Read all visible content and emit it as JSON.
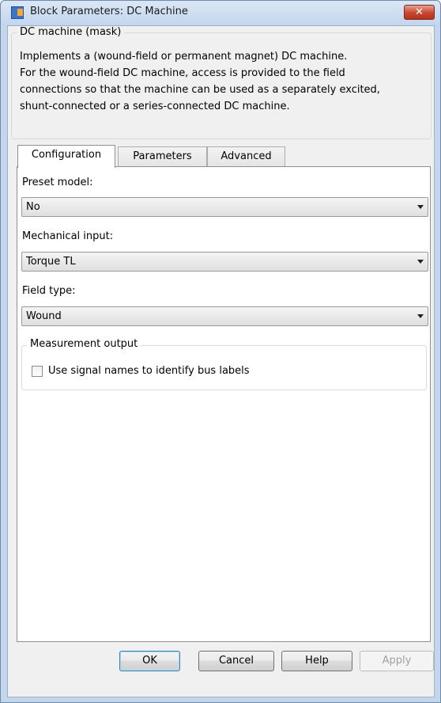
{
  "window": {
    "title": "Block Parameters: DC Machine",
    "close_label": "✕"
  },
  "description": {
    "legend": "DC machine (mask)",
    "text": "Implements a (wound-field or permanent magnet) DC machine.\nFor the wound-field DC machine, access is provided to the field\nconnections so that the machine can be used as a separately excited,\nshunt-connected or a series-connected  DC machine."
  },
  "tabs": [
    {
      "label": "Configuration",
      "active": true
    },
    {
      "label": "Parameters",
      "active": false
    },
    {
      "label": "Advanced",
      "active": false
    }
  ],
  "configuration": {
    "preset_model": {
      "label": "Preset  model:",
      "value": "No"
    },
    "mechanical_input": {
      "label": "Mechanical input:",
      "value": "Torque TL"
    },
    "field_type": {
      "label": "Field type:",
      "value": "Wound"
    },
    "measurement": {
      "legend": "Measurement output",
      "checkbox_label": "Use signal names to identify bus labels",
      "checked": false
    }
  },
  "buttons": {
    "ok": "OK",
    "cancel": "Cancel",
    "help": "Help",
    "apply": "Apply"
  }
}
